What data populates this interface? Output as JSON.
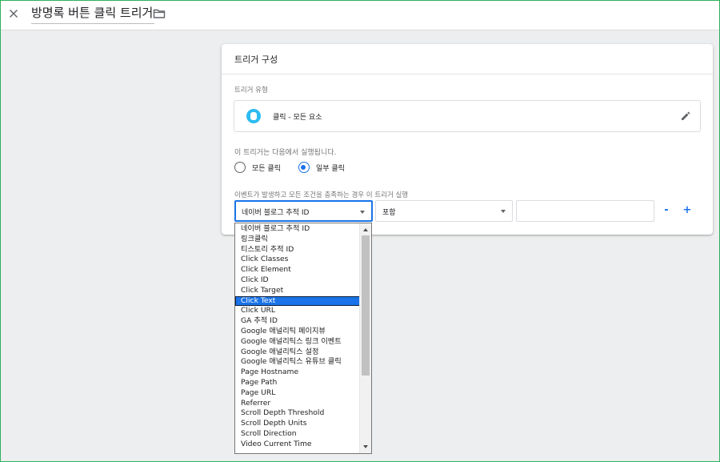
{
  "header": {
    "title": "방명록 버튼 클릭 트리거",
    "close_icon": "close-icon",
    "folder_icon": "folder-icon"
  },
  "card": {
    "title": "트리거 구성",
    "type_section_label": "트리거 유형",
    "trigger_type": "클릭 - 모든 요소",
    "fires_on_label": "이 트리거는 다음에서 실행됩니다.",
    "radio_all": "모든 클릭",
    "radio_some": "일부 클릭",
    "radio_selected": "일부 클릭",
    "condition_label": "이벤트가 발생하고 모든 조건을 충족하는 경우 이 트리거 실행",
    "condition": {
      "variable": "네이버 블로그 추적 ID",
      "operator": "포함",
      "value": "",
      "remove_label": "-",
      "add_label": "+"
    }
  },
  "dropdown": {
    "selected": "Click Text",
    "options": [
      "네이버 블로그 추적 ID",
      "링크클릭",
      "티스토리 추적 ID",
      "Click Classes",
      "Click Element",
      "Click ID",
      "Click Target",
      "Click Text",
      "Click URL",
      "GA 추적 ID",
      "Google 애널리틱 페이지뷰",
      "Google 애널리틱스 링크 이벤트",
      "Google 애널리틱스 설정",
      "Google 애널리틱스 유튜브 클릭",
      "Page Hostname",
      "Page Path",
      "Page URL",
      "Referrer",
      "Scroll Depth Threshold",
      "Scroll Depth Units",
      "Scroll Direction",
      "Video Current Time"
    ]
  },
  "colors": {
    "accent": "#1a73e8",
    "trigger_icon": "#2cbcf0",
    "frame_border": "#2fb05a"
  }
}
